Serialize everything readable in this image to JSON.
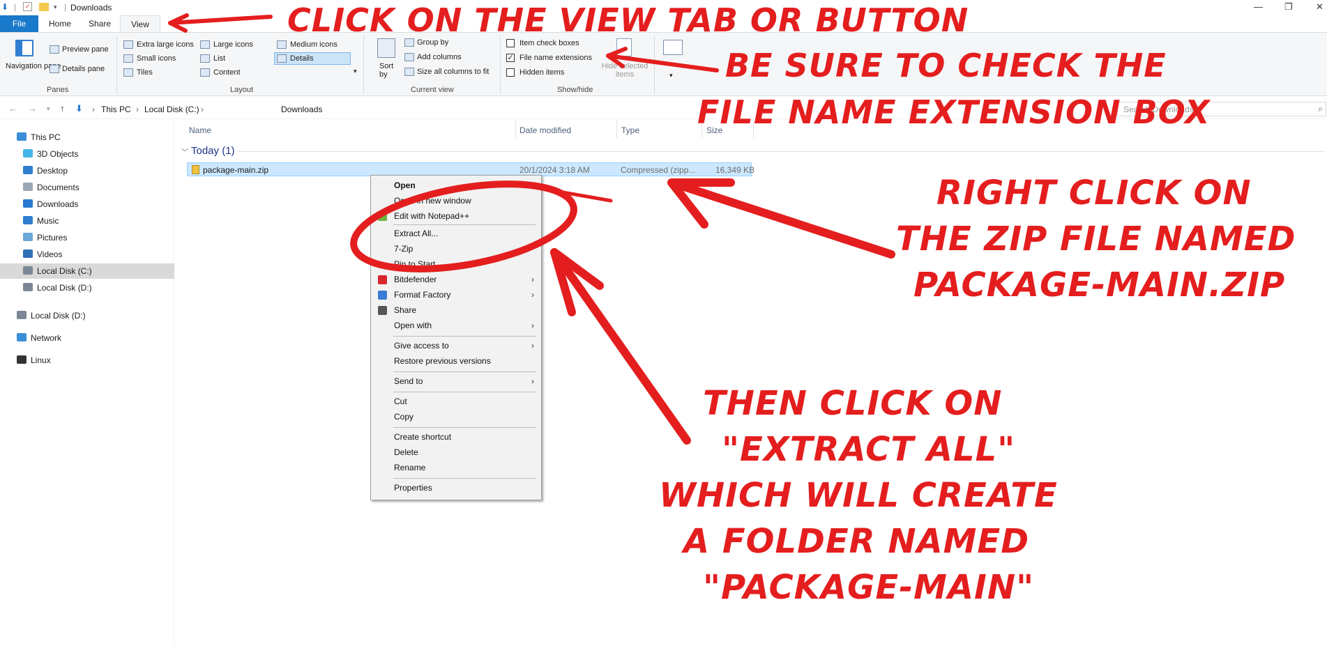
{
  "window": {
    "title": "Downloads",
    "qa_icons": [
      "quick-access-down-arrow-icon",
      "properties-check-icon",
      "new-folder-icon",
      "customize-dropdown-icon"
    ]
  },
  "ribbon": {
    "tabs": [
      "File",
      "Home",
      "Share",
      "View"
    ],
    "active_tab": "View",
    "panes": {
      "label": "Panes",
      "navigation_pane": "Navigation pane",
      "preview_pane": "Preview pane",
      "details_pane": "Details pane"
    },
    "layout": {
      "label": "Layout",
      "options": [
        "Extra large icons",
        "Large icons",
        "Medium icons",
        "Small icons",
        "List",
        "Details",
        "Tiles",
        "Content"
      ],
      "selected": "Details"
    },
    "current_view": {
      "label": "Current view",
      "sort_by": "Sort by",
      "group_by": "Group by",
      "add_columns": "Add columns",
      "size_all_columns": "Size all columns to fit"
    },
    "show_hide": {
      "label": "Show/hide",
      "item_check_boxes": "Item check boxes",
      "item_check_boxes_checked": false,
      "file_name_extensions": "File name extensions",
      "file_name_extensions_checked": true,
      "hidden_items": "Hidden items",
      "hidden_items_checked": false,
      "hide_selected_items": "Hide selected items"
    }
  },
  "address": {
    "crumbs": [
      "This PC",
      "Local Disk (C:)",
      "Downloads"
    ],
    "search_placeholder": "Search Downloads"
  },
  "nav": {
    "items": [
      {
        "label": "This PC",
        "icon": "computer-icon",
        "color": "#3b8fd9"
      },
      {
        "label": "3D Objects",
        "icon": "cube-icon",
        "color": "#45b6e8"
      },
      {
        "label": "Desktop",
        "icon": "desktop-icon",
        "color": "#2f7fd1"
      },
      {
        "label": "Documents",
        "icon": "document-icon",
        "color": "#9aa7b5"
      },
      {
        "label": "Downloads",
        "icon": "download-arrow-icon",
        "color": "#2878d0"
      },
      {
        "label": "Music",
        "icon": "music-note-icon",
        "color": "#2f7fd1"
      },
      {
        "label": "Pictures",
        "icon": "picture-icon",
        "color": "#6aa9d8"
      },
      {
        "label": "Videos",
        "icon": "video-icon",
        "color": "#2f6fb8"
      },
      {
        "label": "Local Disk (C:)",
        "icon": "disk-icon",
        "color": "#7b8794"
      },
      {
        "label": "Local Disk (D:)",
        "icon": "disk-icon",
        "color": "#7b8794"
      },
      {
        "label": "Local Disk (D:)",
        "icon": "disk-icon",
        "color": "#7b8794"
      },
      {
        "label": "Network",
        "icon": "network-icon",
        "color": "#3b8fd9"
      },
      {
        "label": "Linux",
        "icon": "penguin-icon",
        "color": "#333333"
      }
    ],
    "selected": "Local Disk (C:)"
  },
  "content": {
    "columns": [
      "Name",
      "Date modified",
      "Type",
      "Size"
    ],
    "group": "Today (1)",
    "file": {
      "name": "package-main.zip",
      "date": "20/1/2024 3:18 AM",
      "type": "Compressed (zipp...",
      "size": "16,349 KB"
    }
  },
  "context_menu": {
    "items": [
      "Open",
      "Open in new window",
      "Edit with Notepad++",
      "Extract All...",
      "7-Zip",
      "Pin to Start",
      "Bitdefender",
      "Format Factory",
      "Share",
      "Open with",
      "Give access to",
      "Restore previous versions",
      "Send to",
      "Cut",
      "Copy",
      "Create shortcut",
      "Delete",
      "Rename",
      "Properties"
    ]
  },
  "annotations": {
    "click_view": "CLICK ON THE VIEW TAB OR BUTTON",
    "check_line1": "BE SURE TO CHECK THE",
    "check_line2": "FILE NAME EXTENSION BOX",
    "right_click_line1": "RIGHT CLICK ON",
    "right_click_line2": "THE ZIP FILE NAMED",
    "right_click_line3": "PACKAGE-MAIN.ZIP",
    "extract_line1": "THEN CLICK ON",
    "extract_line2": "\"EXTRACT ALL\"",
    "extract_line3": "WHICH WILL CREATE",
    "extract_line4": "A FOLDER NAMED",
    "extract_line5": "\"PACKAGE-MAIN\"",
    "color": "#e41e1e"
  }
}
